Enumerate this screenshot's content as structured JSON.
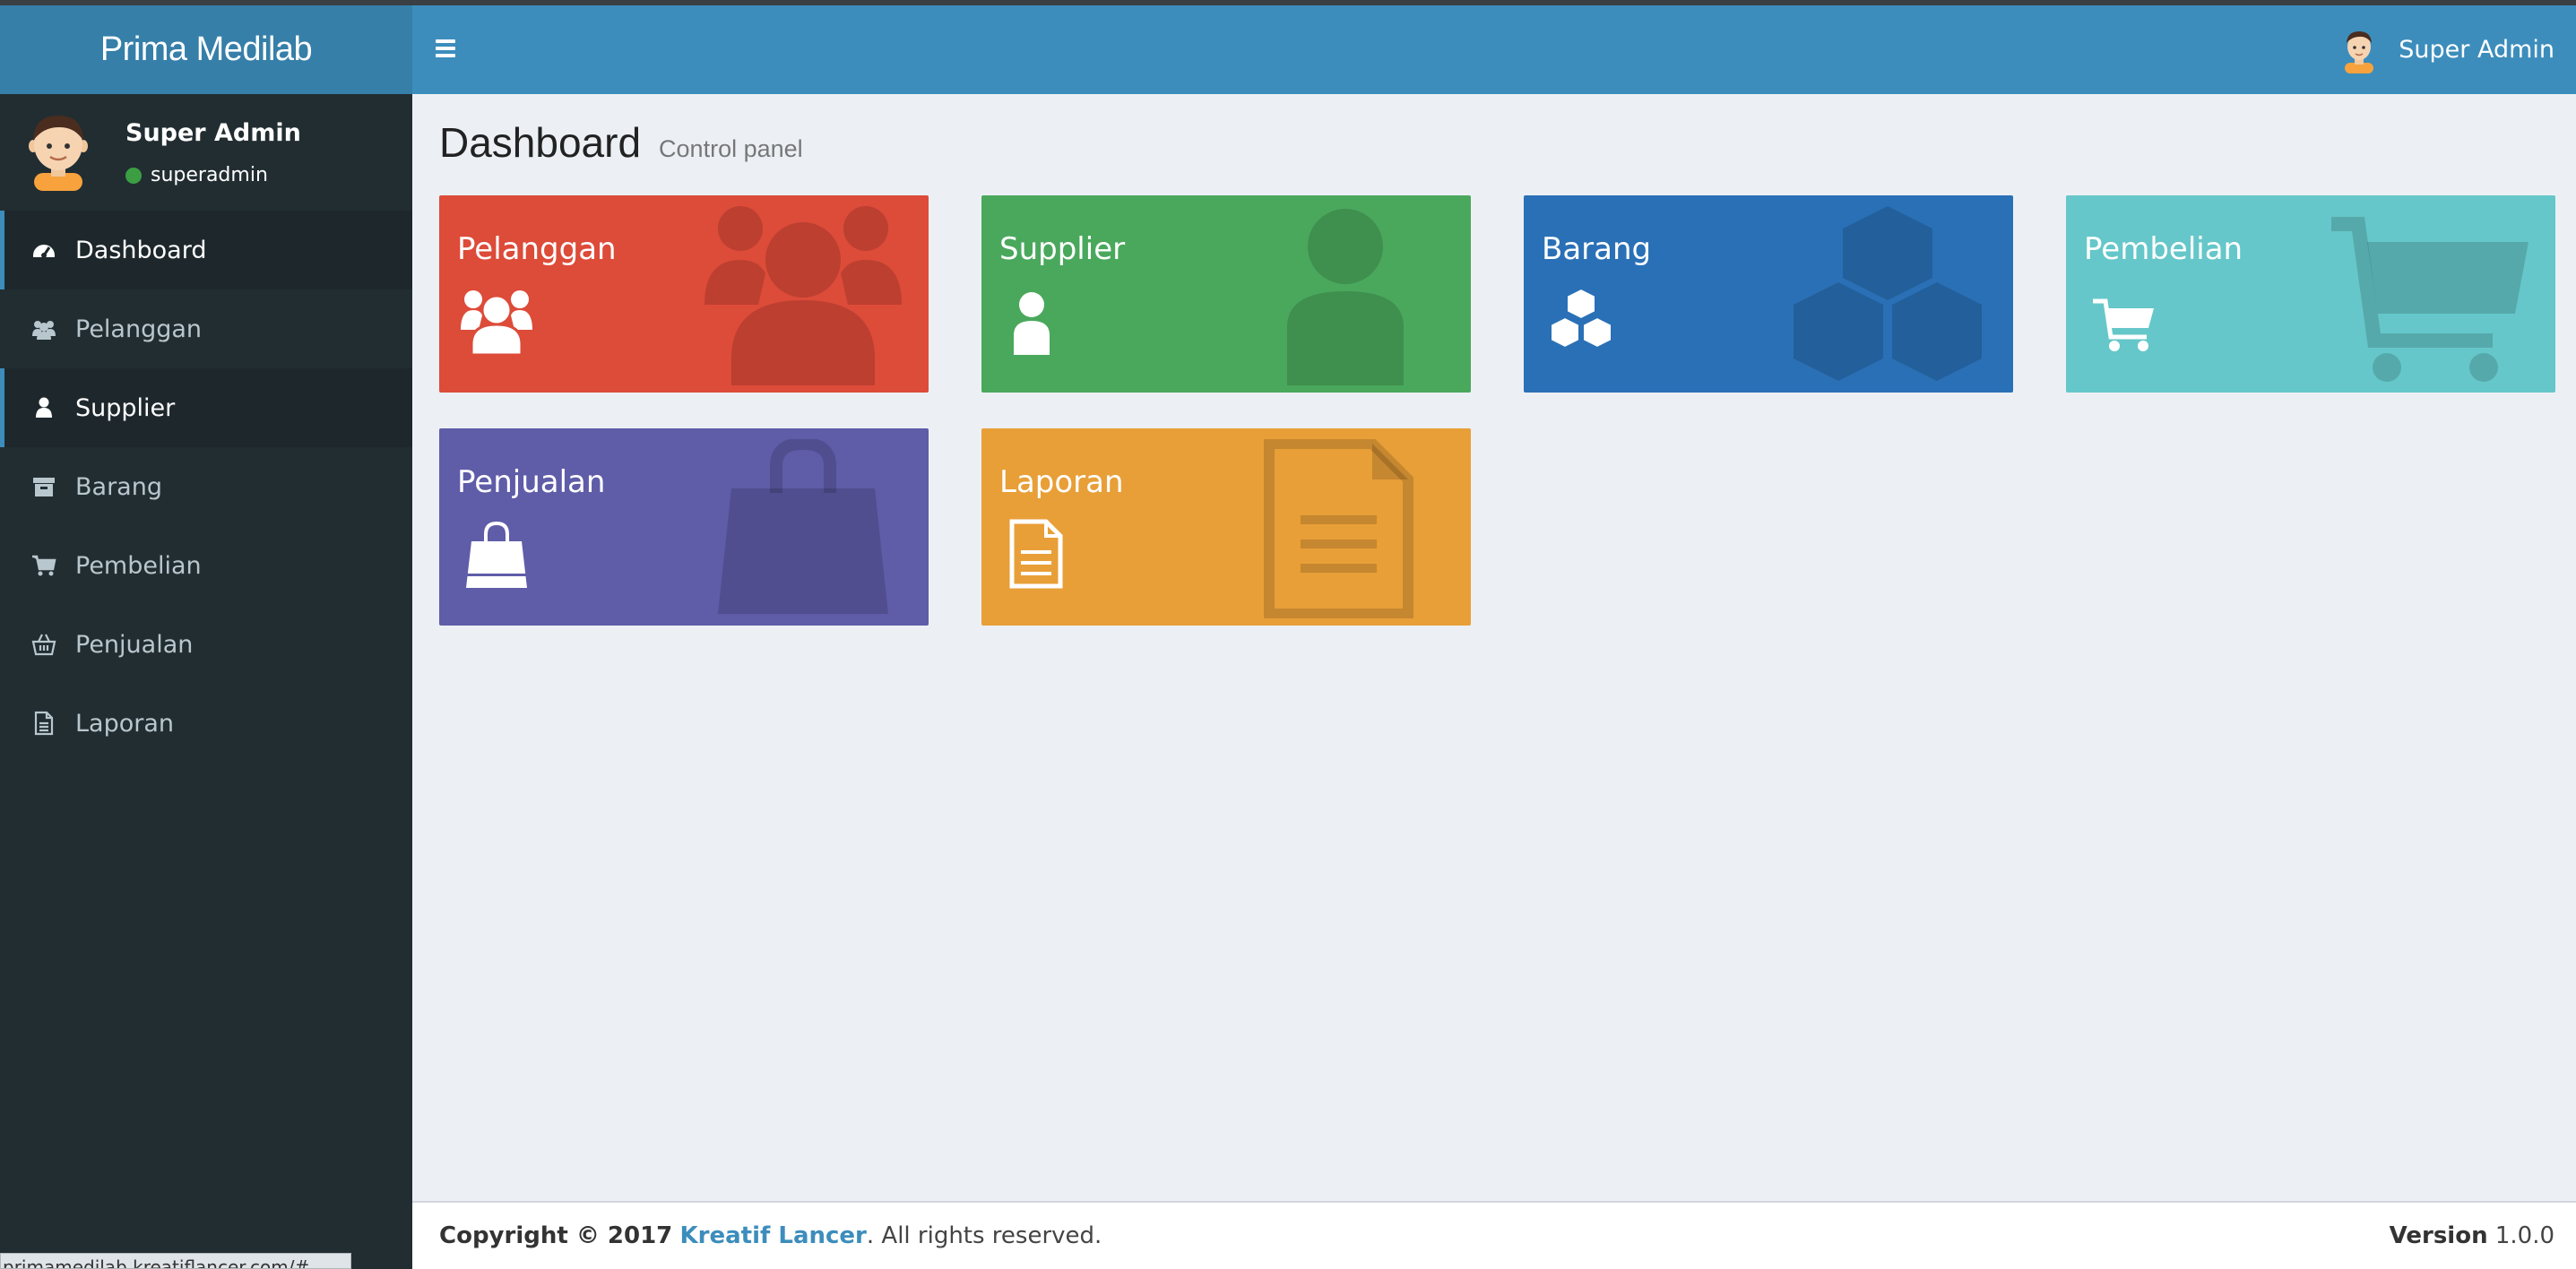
{
  "brand": "Prima Medilab",
  "header": {
    "user_name": "Super Admin"
  },
  "user_panel": {
    "name": "Super Admin",
    "status": "superadmin"
  },
  "sidebar": {
    "items": [
      {
        "label": "Dashboard",
        "icon": "dashboard-icon"
      },
      {
        "label": "Pelanggan",
        "icon": "users-icon"
      },
      {
        "label": "Supplier",
        "icon": "user-icon"
      },
      {
        "label": "Barang",
        "icon": "archive-icon"
      },
      {
        "label": "Pembelian",
        "icon": "cart-icon"
      },
      {
        "label": "Penjualan",
        "icon": "basket-icon"
      },
      {
        "label": "Laporan",
        "icon": "document-icon"
      }
    ],
    "active": [
      "Dashboard",
      "Supplier"
    ]
  },
  "page": {
    "title": "Dashboard",
    "subtitle": "Control panel"
  },
  "tiles": [
    {
      "title": "Pelanggan",
      "icon": "users-icon",
      "color": "#dd4b39"
    },
    {
      "title": "Supplier",
      "icon": "user-icon",
      "color": "#00a65a"
    },
    {
      "title": "Barang",
      "icon": "cubes-icon",
      "color": "#0073b7"
    },
    {
      "title": "Pembelian",
      "icon": "cart-icon",
      "color": "#39cccc"
    },
    {
      "title": "Penjualan",
      "icon": "shopping-bag-icon",
      "color": "#605ca8"
    },
    {
      "title": "Laporan",
      "icon": "document-icon",
      "color": "#f39c12"
    }
  ],
  "footer": {
    "copyright_prefix": "Copyright © 2017",
    "company": "Kreatif Lancer",
    "suffix": ". All rights reserved.",
    "version_label": "Version",
    "version": "1.0.0"
  },
  "statusbar": {
    "url": "primamedilab.kreatiflancer.com/#"
  }
}
